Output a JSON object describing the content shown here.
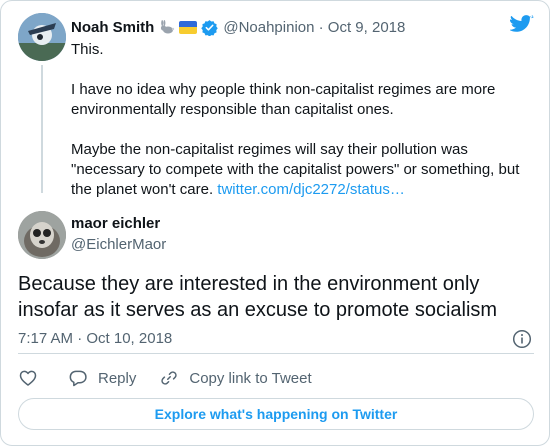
{
  "parent_tweet": {
    "name": "Noah Smith",
    "handle_meta": "@Noahpinion · Oct 9, 2018",
    "emoji_icon": "rabbit-emoji",
    "flag_icon": "ukraine-flag",
    "text": [
      "This.",
      "I have no idea why people think non-capitalist regimes are more environmentally responsible than capitalist ones.",
      "Maybe the non-capitalist regimes will say their pollution was \"necessary to compete with the capitalist powers\" or something, but the planet won't care."
    ],
    "link": "twitter.com/djc2272/status…"
  },
  "main_tweet": {
    "name": "maor eichler",
    "handle": "@EichlerMaor",
    "text": "Because they are interested in the environment only insofar as it serves as an excuse to promote socialism",
    "timestamp": "7:17 AM · Oct 10, 2018"
  },
  "actions": {
    "like_icon": "heart-icon",
    "reply_label": "Reply",
    "copy_label": "Copy link to Tweet"
  },
  "explore_label": "Explore what's happening on Twitter",
  "colors": {
    "accent": "#1d9bf0",
    "secondary_text": "#536471",
    "border": "#cfd9de"
  }
}
